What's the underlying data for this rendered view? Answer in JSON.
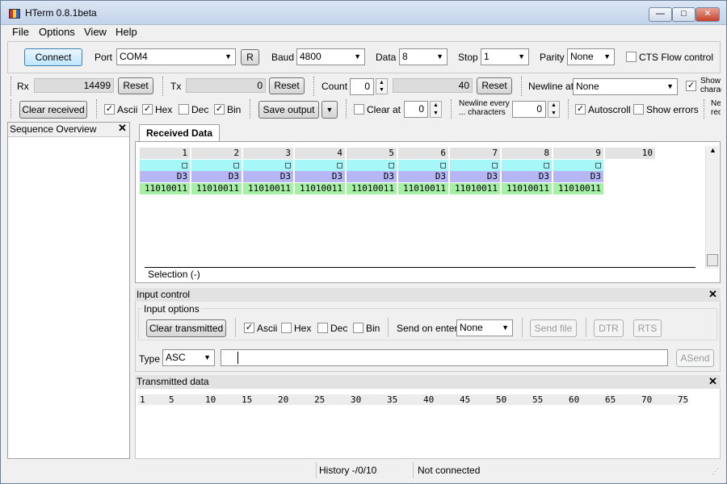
{
  "window": {
    "title": "HTerm 0.8.1beta",
    "min": "—",
    "max": "□",
    "close": "✕"
  },
  "menu": [
    "File",
    "Options",
    "View",
    "Help"
  ],
  "conn": {
    "connect": "Connect",
    "port_label": "Port",
    "port": "COM4",
    "r": "R",
    "baud_label": "Baud",
    "baud": "4800",
    "data_label": "Data",
    "data": "8",
    "stop_label": "Stop",
    "stop": "1",
    "parity_label": "Parity",
    "parity": "None",
    "cts": "CTS Flow control"
  },
  "counters": {
    "rx_label": "Rx",
    "rx": "14499",
    "reset": "Reset",
    "tx_label": "Tx",
    "tx": "0",
    "count_label": "Count",
    "count": "0",
    "count_field": "40",
    "newline_label": "Newline at",
    "newline": "None",
    "show_chars": "Show characters"
  },
  "display": {
    "clear_received": "Clear received",
    "ascii": "Ascii",
    "hex": "Hex",
    "dec": "Dec",
    "bin": "Bin",
    "save_output": "Save output",
    "clear_at": "Clear at",
    "clear_at_val": "0",
    "newline_every": "Newline every ... characters",
    "newline_every_val": "0",
    "autoscroll": "Autoscroll",
    "show_errors": "Show errors",
    "ne": "Newline received"
  },
  "sequence": {
    "title": "Sequence Overview"
  },
  "received": {
    "tab": "Received Data",
    "columns": [
      "1",
      "2",
      "3",
      "4",
      "5",
      "6",
      "7",
      "8",
      "9",
      "10"
    ],
    "ascii_row": [
      "□",
      "□",
      "□",
      "□",
      "□",
      "□",
      "□",
      "□",
      "□"
    ],
    "hex_row": [
      "D3",
      "D3",
      "D3",
      "D3",
      "D3",
      "D3",
      "D3",
      "D3",
      "D3"
    ],
    "bin_row": [
      "11010011",
      "11010011",
      "11010011",
      "11010011",
      "11010011",
      "11010011",
      "11010011",
      "11010011",
      "11010011"
    ],
    "selection": "Selection (-)"
  },
  "input": {
    "title": "Input control",
    "options": "Input options",
    "clear_transmitted": "Clear transmitted",
    "ascii": "Ascii",
    "hex": "Hex",
    "dec": "Dec",
    "bin": "Bin",
    "send_on_enter": "Send on enter",
    "send_on_enter_val": "None",
    "send_file": "Send file",
    "dtr": "DTR",
    "rts": "RTS",
    "type_label": "Type",
    "type_val": "ASC",
    "asend": "ASend"
  },
  "transmitted": {
    "title": "Transmitted data",
    "ruler": [
      "1",
      "5",
      "10",
      "15",
      "20",
      "25",
      "30",
      "35",
      "40",
      "45",
      "50",
      "55",
      "60",
      "65",
      "70",
      "75"
    ]
  },
  "status": {
    "history": "History -/0/10",
    "conn": "Not connected"
  }
}
